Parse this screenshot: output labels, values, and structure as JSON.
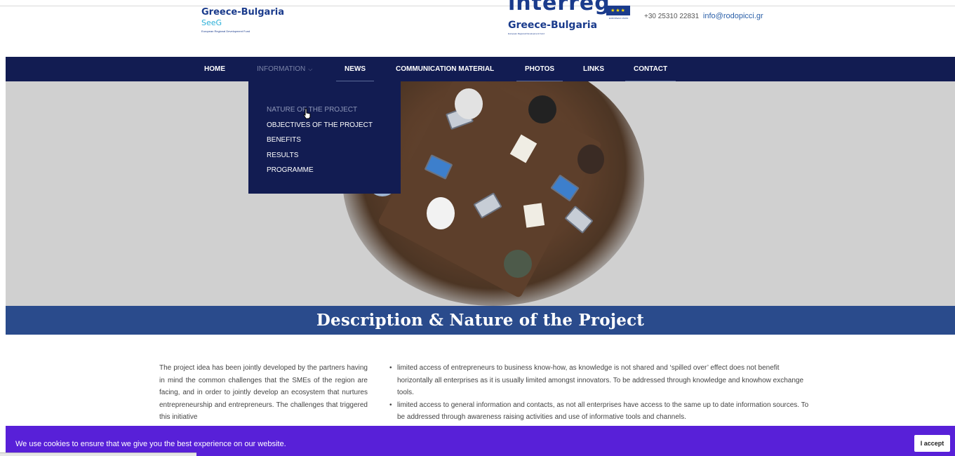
{
  "header": {
    "left_logo": {
      "line1": "Greece-Bulgaria",
      "line2": "SeeG",
      "line3": "European Regional Development Fund"
    },
    "center_logo": {
      "wordmark": "interreg",
      "eu_label": "EUROPEAN UNION",
      "programme": "Greece-Bulgaria",
      "fund": "European Regional Development Fund"
    },
    "phone": "+30 25310 22831",
    "email": "info@rodopicci.gr"
  },
  "nav": {
    "items": [
      {
        "label": "HOME"
      },
      {
        "label": "INFORMATION"
      },
      {
        "label": "NEWS"
      },
      {
        "label": "COMMUNICATION MATERIAL"
      },
      {
        "label": "PHOTOS"
      },
      {
        "label": "LINKS"
      },
      {
        "label": "CONTACT"
      }
    ],
    "dropdown": [
      {
        "label": "NATURE OF THE PROJECT"
      },
      {
        "label": "OBJECTIVES OF THE PROJECT"
      },
      {
        "label": "BENEFITS"
      },
      {
        "label": "RESULTS"
      },
      {
        "label": "PROGRAMME"
      }
    ]
  },
  "page_title": "Description & Nature of the Project",
  "content": {
    "left_paragraph": "The project idea has been jointly developed by the partners having in mind the common challenges that the SMEs of the region are facing, and in order to jointly develop an ecosystem that nurtures entrepreneurship and entrepreneurs. The challenges that triggered this initiative",
    "bullets": [
      "limited access of entrepreneurs to business know-how, as knowledge is not shared and ‘spilled over’ effect does not benefit horizontally all enterprises as it is usually limited amongst innovators. To be addressed through knowledge and knowhow exchange tools.",
      "limited access to general information and contacts, as not all enterprises have access to the same up to date information sources. To be addressed through awareness raising activities and use of informative tools and channels."
    ]
  },
  "cookie": {
    "text": "We use cookies to ensure that we give you the best experience on our website.",
    "button": "I accept"
  },
  "colors": {
    "nav_bg": "#121c52",
    "title_band": "#2a4b8c",
    "cookie_bg": "#5820d8",
    "brand_blue": "#1a3b8c"
  }
}
